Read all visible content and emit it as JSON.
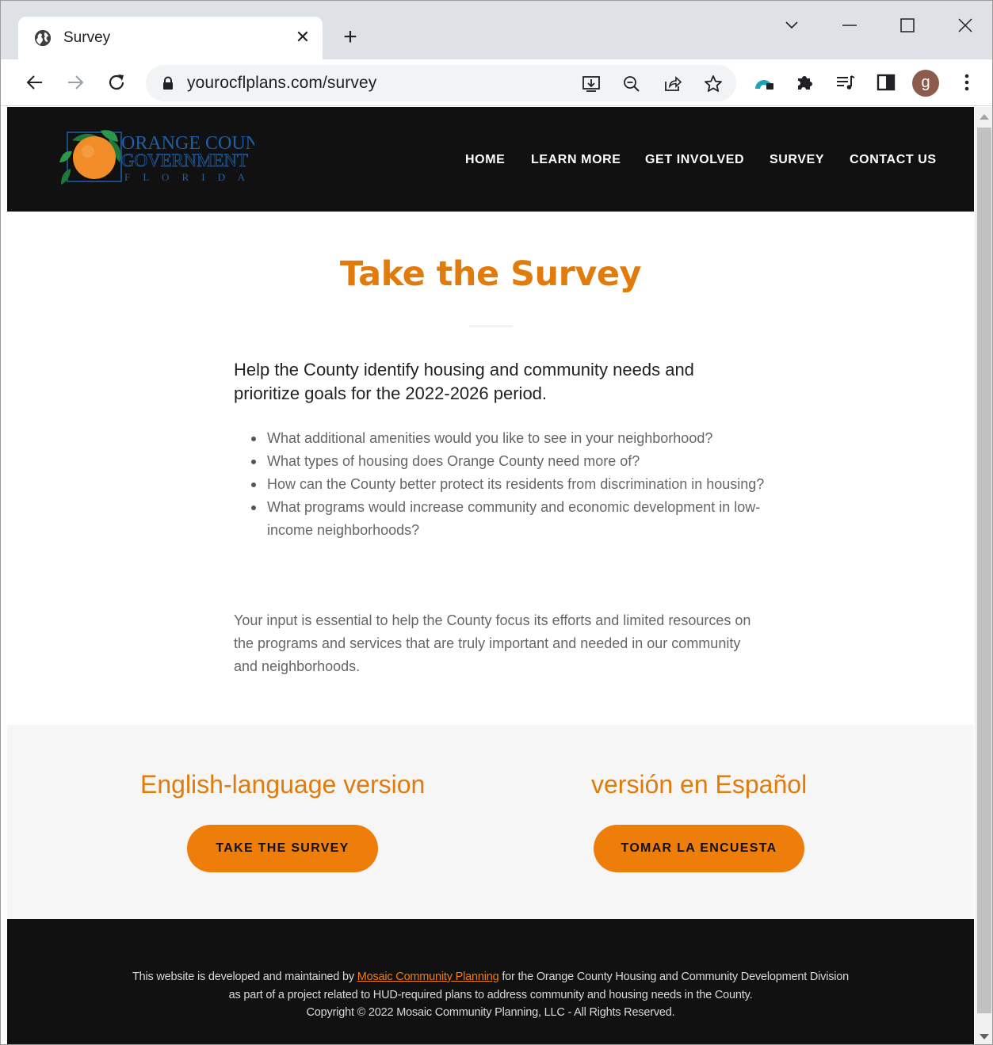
{
  "browser": {
    "tab_title": "Survey",
    "url": "yourocflplans.com/survey",
    "profile_initial": "g",
    "icons": {
      "tab": "globe-icon",
      "close": "close-icon",
      "new_tab": "plus-icon",
      "back": "arrow-left-icon",
      "forward": "arrow-right-icon",
      "reload": "reload-icon",
      "lock": "lock-icon",
      "install": "install-app-icon",
      "zoom": "zoom-out-icon",
      "share": "share-icon",
      "bookmark": "star-icon",
      "extension_colored": "extension-icon",
      "extensions": "puzzle-icon",
      "media": "media-queue-icon",
      "side_panel": "side-panel-icon",
      "menu": "kebab-menu-icon",
      "tab_search": "chevron-down-icon",
      "minimize": "minimize-icon",
      "maximize": "maximize-icon",
      "close_window": "close-window-icon"
    }
  },
  "site": {
    "logo": {
      "line1": "ORANGE COUNTY",
      "line2": "GOVERNMENT",
      "line3": "F L O R I D A"
    },
    "nav": {
      "home": "HOME",
      "learn_more": "LEARN MORE",
      "get_involved": "GET INVOLVED",
      "survey": "SURVEY",
      "contact_us": "CONTACT US"
    },
    "title": "Take the Survey",
    "lead": "Help the County identify housing and community needs and prioritize goals for the 2022-2026 period.",
    "bullets": [
      "What additional amenities would you like to see in your neighborhood?",
      "What types of housing does Orange County need more of?",
      "How can the County better protect its residents from discrimination in housing?",
      "What programs would increase community and economic development in low-income neighborhoods?"
    ],
    "paragraph": "Your input is essential to help the County focus its efforts and limited resources on the programs and services that are truly important and needed in our community and neighborhoods.",
    "english": {
      "heading": "English-language version",
      "button": "TAKE THE SURVEY"
    },
    "spanish": {
      "heading": "versión en Español",
      "button": "TOMAR LA ENCUESTA"
    },
    "footer": {
      "line1_before": "This website is developed and maintained by ",
      "line1_link": "Mosaic Community Planning",
      "line1_after": " for the Orange County Housing and Community Development Division",
      "line2": "as part of a project related to HUD-required plans to address community and housing needs in the County.",
      "line3": "Copyright © 2022 Mosaic Community Planning, LLC - All Rights Reserved."
    }
  },
  "colors": {
    "accent": "#ef7d0a",
    "heading_orange": "#e07b0c",
    "header_bg": "#111111",
    "band_bg": "#f6f6f6"
  }
}
